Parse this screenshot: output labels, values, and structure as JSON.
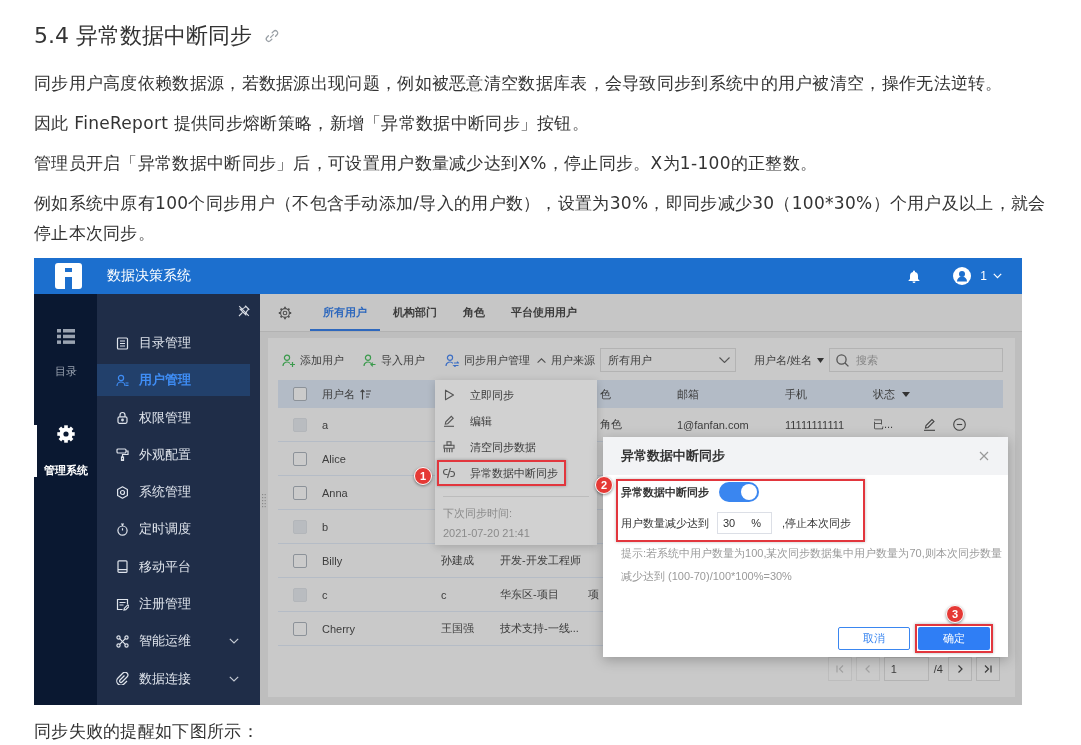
{
  "heading": {
    "text": "5.4 异常数据中断同步"
  },
  "paragraphs": [
    "同步用户高度依赖数据源，若数据源出现问题，例如被恶意清空数据库表，会导致同步到系统中的用户被清空，操作无法逆转。",
    "因此 FineReport 提供同步熔断策略，新增「异常数据中断同步」按钮。",
    "管理员开启「异常数据中断同步」后，可设置用户数量减少达到X%，停止同步。X为1-100的正整数。",
    "例如系统中原有100个同步用户（不包含手动添加/导入的用户数），设置为30%，即同步减少30（100*30%）个用户及以上，就会停止本次同步。"
  ],
  "screenshot": {
    "top_bar": {
      "title": "数据决策系统",
      "user_name": "1"
    },
    "rail": [
      {
        "label": "目录",
        "selected": false
      },
      {
        "label": "管理系统",
        "selected": true
      }
    ],
    "menu": [
      {
        "label": "目录管理",
        "selected": false,
        "has_submenu": false
      },
      {
        "label": "用户管理",
        "selected": true,
        "has_submenu": false
      },
      {
        "label": "权限管理",
        "selected": false,
        "has_submenu": false
      },
      {
        "label": "外观配置",
        "selected": false,
        "has_submenu": false
      },
      {
        "label": "系统管理",
        "selected": false,
        "has_submenu": false
      },
      {
        "label": "定时调度",
        "selected": false,
        "has_submenu": false
      },
      {
        "label": "移动平台",
        "selected": false,
        "has_submenu": false
      },
      {
        "label": "注册管理",
        "selected": false,
        "has_submenu": false
      },
      {
        "label": "智能运维",
        "selected": false,
        "has_submenu": true
      },
      {
        "label": "数据连接",
        "selected": false,
        "has_submenu": true
      }
    ],
    "tabs": [
      {
        "label": "所有用户",
        "selected": true
      },
      {
        "label": "机构部门",
        "selected": false
      },
      {
        "label": "角色",
        "selected": false
      },
      {
        "label": "平台使用用户",
        "selected": false
      }
    ],
    "toolbar": {
      "buttons": [
        {
          "label": "添加用户"
        },
        {
          "label": "导入用户"
        },
        {
          "label": "同步用户管理"
        }
      ],
      "source_toggle": {
        "label": "用户来源",
        "expanded": true
      },
      "source_select": {
        "value": "所有用户"
      },
      "search_by": {
        "label": "用户名/姓名"
      },
      "search": {
        "placeholder": "搜索"
      }
    },
    "table": {
      "header_checkbox": {
        "checked": false
      },
      "columns": {
        "username": "用户名",
        "column_4": "色",
        "email": "邮箱",
        "phone": "手机",
        "status": "状态"
      },
      "rows": [
        {
          "checkbox": {
            "checked": false,
            "disabled": true
          },
          "username": "a",
          "column_4": "角色",
          "email": "1@fanfan.com",
          "phone": "11111111111",
          "status": "已...",
          "actions": [
            {
              "kind": "edit"
            },
            {
              "kind": "remove"
            }
          ]
        },
        {
          "checkbox": {
            "checked": false,
            "disabled": false
          },
          "username": "Alice"
        },
        {
          "checkbox": {
            "checked": false,
            "disabled": false
          },
          "username": "Anna"
        },
        {
          "checkbox": {
            "checked": false,
            "disabled": true
          },
          "username": "b"
        },
        {
          "checkbox": {
            "checked": false,
            "disabled": false
          },
          "username": "Billy",
          "column_2": "孙建成",
          "column_3": "开发-开发工程师"
        },
        {
          "checkbox": {
            "checked": false,
            "disabled": true
          },
          "username": "c",
          "column_2": "c",
          "column_3": "华东区-项目",
          "column_4": "项"
        },
        {
          "checkbox": {
            "checked": false,
            "disabled": false
          },
          "username": "Cherry",
          "column_2": "王国强",
          "column_3": "技术支持-一线..."
        }
      ]
    },
    "pagination": {
      "buttons": [
        {
          "kind": "first",
          "disabled": true
        },
        {
          "kind": "prev",
          "disabled": true
        },
        {
          "kind": "next",
          "disabled": false
        },
        {
          "kind": "last",
          "disabled": false
        }
      ],
      "page": "1",
      "total": "/4"
    },
    "sync_menu": {
      "items": [
        {
          "label": "立即同步"
        },
        {
          "label": "编辑"
        },
        {
          "label": "清空同步数据"
        },
        {
          "label": "异常数据中断同步",
          "callout": "1"
        }
      ],
      "next_sync_label": "下次同步时间:",
      "next_sync_time": "2021-07-20 21:41"
    },
    "dialog": {
      "title": "异常数据中断同步",
      "settings": {
        "callout": "2",
        "toggle": {
          "label": "异常数据中断同步",
          "on": true
        },
        "threshold": {
          "label": "用户数量减少达到",
          "value": "30",
          "unit": "%",
          "suffix": ",停止本次同步"
        }
      },
      "hint": "提示:若系统中用户数量为100,某次同步数据集中用户数量为70,则本次同步数量减少达到 (100-70)/100*100%=30%",
      "buttons": [
        {
          "label": "取消",
          "kind": "secondary"
        },
        {
          "label": "确定",
          "kind": "primary",
          "callout": "3"
        }
      ]
    }
  },
  "caption": "同步失败的提醒如下图所示："
}
